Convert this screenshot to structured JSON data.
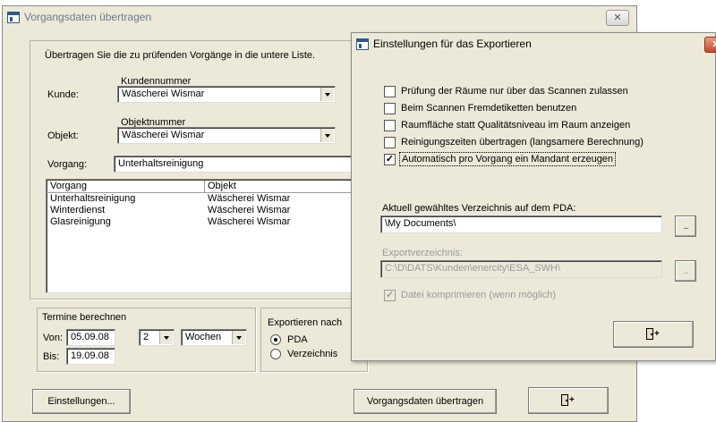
{
  "main": {
    "title": "Vorgangsdaten übertragen",
    "intro": "Übertragen Sie die zu prüfenden Vorgänge in die untere Liste.",
    "kundennummer_label": "Kundennummer",
    "kunde_label": "Kunde:",
    "kunde_value": "Wäscherei Wismar",
    "objektnummer_label": "Objektnummer",
    "objekt_label": "Objekt:",
    "objekt_value": "Wäscherei Wismar",
    "vorgang_label": "Vorgang:",
    "vorgang_value": "Unterhaltsreinigung",
    "list": {
      "headers": [
        "Vorgang",
        "Objekt"
      ],
      "rows": [
        {
          "vorgang": "Unterhaltsreinigung",
          "objekt": "Wäscherei Wismar"
        },
        {
          "vorgang": "Winterdienst",
          "objekt": "Wäscherei Wismar"
        },
        {
          "vorgang": "Glasreinigung",
          "objekt": "Wäscherei Wismar"
        }
      ]
    },
    "termine": {
      "title": "Termine berechnen",
      "von_label": "Von:",
      "von_value": "05.09.08",
      "bis_label": "Bis:",
      "bis_value": "19.09.08",
      "count_value": "2",
      "unit_value": "Wochen"
    },
    "export": {
      "title": "Exportieren nach",
      "options": [
        "PDA",
        "Verzeichnis"
      ],
      "selected": "PDA"
    },
    "buttons": {
      "einstellungen": "Einstellungen...",
      "uebertragen": "Vorgangsdaten übertragen"
    }
  },
  "dialog": {
    "title": "Einstellungen für das Exportieren",
    "checkboxes": [
      {
        "label": "Prüfung der Räume nur über das Scannen zulassen",
        "checked": false
      },
      {
        "label": "Beim Scannen Fremdetiketten benutzen",
        "checked": false
      },
      {
        "label": "Raumfläche statt Qualitätsniveau im Raum anzeigen",
        "checked": false
      },
      {
        "label": "Reinigungszeiten übertragen (langsamere Berechnung)",
        "checked": false
      },
      {
        "label": "Automatisch pro Vorgang ein Mandant erzeugen",
        "checked": true
      }
    ],
    "pda_dir_label": "Aktuell gewähltes Verzeichnis auf dem PDA:",
    "pda_dir_value": "\\My Documents\\",
    "export_dir_label": "Exportverzeichnis:",
    "export_dir_value": "C:\\D\\DATS\\Kunden\\enercity\\ESA_SWH\\",
    "compress_label": "Datei komprimieren (wenn möglich)",
    "compress_checked": true,
    "browse_label": "...",
    "check_mark": "✓"
  },
  "icons": {
    "close": "close-icon",
    "exit": "exit-door-icon",
    "app": "app-window-icon"
  },
  "colors": {
    "face": "#ece9d8",
    "close_red": "#c24a2e"
  }
}
